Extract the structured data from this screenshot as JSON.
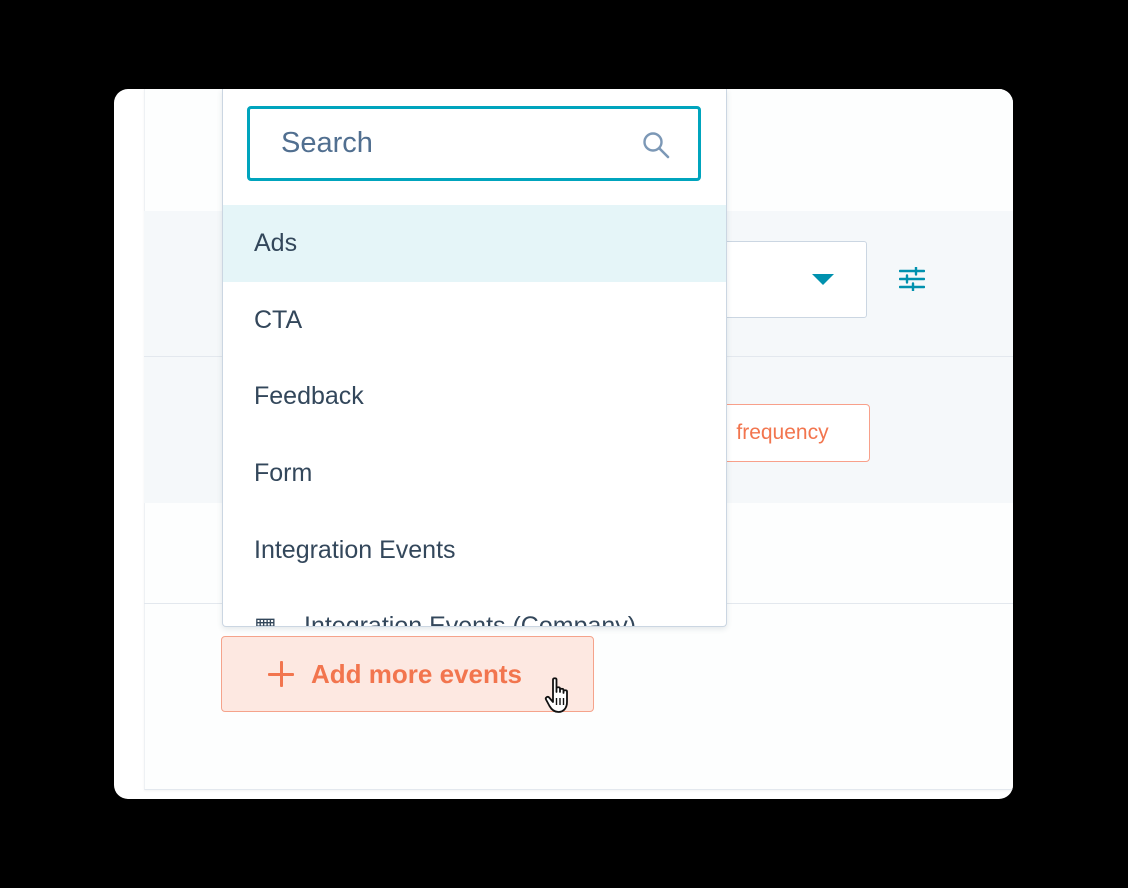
{
  "search": {
    "placeholder": "Search",
    "icon": "search-icon"
  },
  "dropdown": {
    "options": [
      {
        "label": "Ads",
        "active": true
      },
      {
        "label": "CTA",
        "active": false
      },
      {
        "label": "Feedback",
        "active": false
      },
      {
        "label": "Form",
        "active": false
      },
      {
        "label": "Integration Events",
        "active": false
      },
      {
        "label": "Integration Events (Company)",
        "active": false,
        "icon": "company-icon"
      }
    ]
  },
  "filters": {
    "select_caret_icon": "caret-down-icon",
    "settings_icon": "sliders-icon",
    "frequency_label": "frequency"
  },
  "actions": {
    "add_more_events_label": "Add more events",
    "add_icon": "plus-icon"
  },
  "colors": {
    "accent_teal": "#00a4bd",
    "highlight_row": "#e5f5f8",
    "orange": "#f2754e",
    "orange_bg": "#fde8e1",
    "text": "#33475b"
  }
}
